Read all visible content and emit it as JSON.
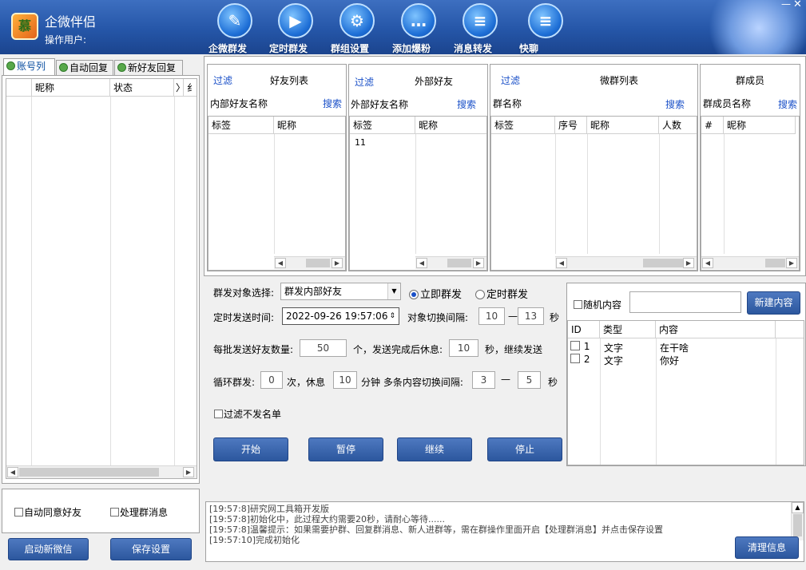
{
  "app": {
    "title": "企微伴侣",
    "operator_label": "操作用户:",
    "logo_text": "慕"
  },
  "nav": [
    {
      "label": "企微群发",
      "icon": "pen-icon"
    },
    {
      "label": "定时群发",
      "icon": "scheduled-send-icon"
    },
    {
      "label": "群组设置",
      "icon": "gear-icon"
    },
    {
      "label": "添加爆粉",
      "icon": "chat-bubble-icon"
    },
    {
      "label": "消息转发",
      "icon": "forward-message-icon"
    },
    {
      "label": "快聊",
      "icon": "quick-chat-icon"
    }
  ],
  "left": {
    "tabs": [
      "账号列",
      "自动回复",
      "新好友回复"
    ],
    "columns": [
      "昵称",
      "状态",
      "〉",
      "纟"
    ],
    "auto_accept_label": "自动同意好友",
    "process_group_label": "处理群消息",
    "start_wechat_label": "启动新微信",
    "save_settings_label": "保存设置"
  },
  "lists": {
    "friends": {
      "filter": "过滤",
      "title": "好友列表",
      "field": "内部好友名称",
      "search": "搜索",
      "cols": [
        "标签",
        "昵称"
      ]
    },
    "external": {
      "filter": "过滤",
      "title": "外部好友",
      "field": "外部好友名称",
      "search": "搜索",
      "cols": [
        "标签",
        "昵称"
      ],
      "rows": [
        [
          "11",
          ""
        ]
      ]
    },
    "groups": {
      "filter": "过滤",
      "title": "微群列表",
      "field": "群名称",
      "search": "搜索",
      "cols": [
        "标签",
        "序号",
        "昵称",
        "人数"
      ]
    },
    "members": {
      "title": "群成员",
      "field": "群成员名称",
      "search": "搜索",
      "cols": [
        "#",
        "昵称"
      ]
    }
  },
  "settings": {
    "target_label": "群发对象选择:",
    "target_value": "群发内部好友",
    "send_now": "立即群发",
    "send_scheduled": "定时群发",
    "time_label": "定时发送时间:",
    "time_value": "2022-09-26 19:57:06",
    "switch_label": "对象切换间隔:",
    "switch_min": "10",
    "dash": "—",
    "switch_max": "13",
    "sec": "秒",
    "batch_label": "每批发送好友数量:",
    "batch_value": "50",
    "batch_mid": "个，发送完成后休息:",
    "rest_value": "10",
    "batch_end": "秒，继续发送",
    "loop_label": "循环群发:",
    "loop_value": "0",
    "loop_mid": "次，休息",
    "loop_rest": "10",
    "loop_end": "分钟 多条内容切换间隔:",
    "multi_min": "3",
    "multi_max": "5",
    "filter_blacklist": "过滤不发名单",
    "start": "开始",
    "pause": "暂停",
    "resume": "继续",
    "stop": "停止"
  },
  "content": {
    "random_label": "随机内容",
    "new_label": "新建内容",
    "cols": [
      "ID",
      "类型",
      "内容"
    ],
    "rows": [
      {
        "id": "1",
        "type": "文字",
        "content": "在干啥"
      },
      {
        "id": "2",
        "type": "文字",
        "content": "你好"
      }
    ]
  },
  "log": {
    "lines": [
      "[19:57:8]研究网工具箱开发版",
      "[19:57:8]初始化中，此过程大约需要20秒，请耐心等待......",
      "[19:57:8]温馨提示：如果需要护群、回复群消息、新人进群等，需在群操作里面开启【处理群消息】并点击保存设置",
      "[19:57:10]完成初始化"
    ],
    "clear_label": "清理信息"
  }
}
